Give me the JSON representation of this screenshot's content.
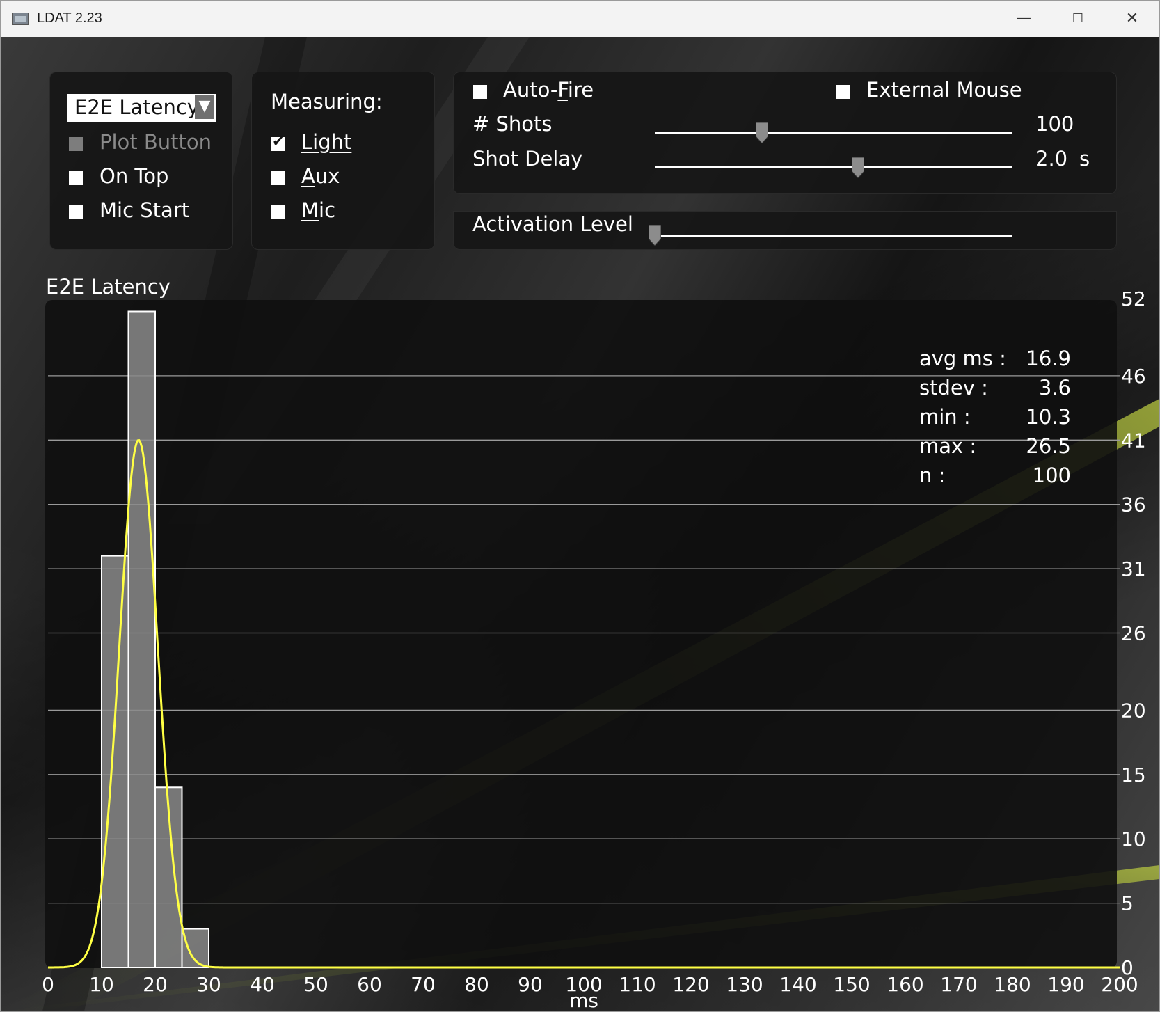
{
  "window": {
    "title": "LDAT 2.23",
    "minimize_glyph": "—",
    "maximize_glyph": "☐",
    "close_glyph": "✕"
  },
  "mode_panel": {
    "dropdown_value": "E2E Latency",
    "dropdown_arrow": "▼",
    "plot_button": "Plot Button",
    "on_top": "On Top",
    "mic_start": "Mic Start"
  },
  "measuring": {
    "heading": "Measuring:",
    "light": "Light",
    "aux_first": "A",
    "aux_rest": "ux",
    "mic_first": "M",
    "mic_rest": "ic"
  },
  "fire": {
    "auto_fire_pre": "Auto-",
    "auto_fire_u": "F",
    "auto_fire_post": "ire",
    "external_mouse": "External Mouse",
    "shots_label": "# Shots",
    "shots_value": "100",
    "shots_level": 0.3,
    "delay_label": "Shot Delay",
    "delay_value": "2.0",
    "delay_unit": "s",
    "delay_level": 0.57
  },
  "activation": {
    "label": "Activation Level",
    "level": 0.0
  },
  "chart_data": {
    "type": "bar",
    "title": "E2E Latency",
    "xlabel": "ms",
    "x_range": [
      0,
      200
    ],
    "x_ticks": [
      0,
      10,
      20,
      30,
      40,
      50,
      60,
      70,
      80,
      90,
      100,
      110,
      120,
      130,
      140,
      150,
      160,
      170,
      180,
      190,
      200
    ],
    "y_range": [
      0,
      52
    ],
    "y_ticks": [
      0,
      5,
      10,
      15,
      20,
      26,
      31,
      36,
      41,
      46,
      52
    ],
    "bin_width": 5,
    "bins": [
      {
        "x0": 10,
        "x1": 15,
        "count": 32
      },
      {
        "x0": 15,
        "x1": 20,
        "count": 51
      },
      {
        "x0": 20,
        "x1": 25,
        "count": 14
      },
      {
        "x0": 25,
        "x1": 30,
        "count": 3
      }
    ],
    "fit_curve": {
      "type": "normal",
      "mean": 16.9,
      "stdev": 3.6,
      "peak": 41,
      "color": "#ffff44"
    },
    "grid": true,
    "stats": [
      {
        "label": "avg ms :",
        "value": "16.9"
      },
      {
        "label": "stdev :",
        "value": "3.6"
      },
      {
        "label": "min :",
        "value": "10.3"
      },
      {
        "label": "max :",
        "value": "26.5"
      },
      {
        "label": "n :",
        "value": "100"
      }
    ]
  }
}
